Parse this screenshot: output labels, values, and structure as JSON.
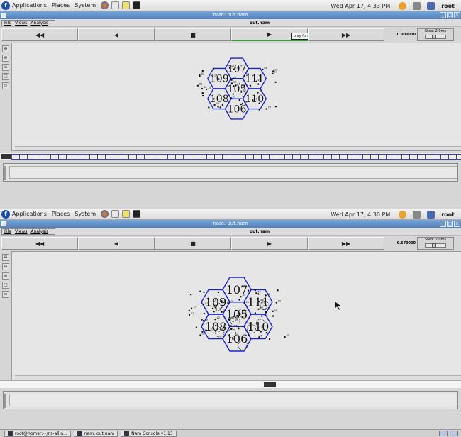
{
  "desktop": {
    "apps_menu": "Applications",
    "places_menu": "Places",
    "system_menu": "System",
    "user": "root"
  },
  "shot1": {
    "clock": "Wed Apr 17,  4:33 PM",
    "window_title": "nam: out.nam",
    "menu": {
      "file": "File",
      "views": "Views",
      "analysis": "Analysis"
    },
    "file_name": "out.nam",
    "controls": {
      "rewind": "◀◀",
      "back": "◀",
      "stop": "■",
      "play": "▶",
      "fastfwd": "▶▶"
    },
    "tooltip": "play forward",
    "time": "0.000000",
    "step_label": "Step: 2.0ms"
  },
  "shot2": {
    "clock": "Wed Apr 17,  4:30 PM",
    "window_title": "nam: out.nam",
    "menu": {
      "file": "File",
      "views": "Views",
      "analysis": "Analysis"
    },
    "file_name": "out.nam",
    "controls": {
      "rewind": "◀◀",
      "back": "◀",
      "stop": "■",
      "play": "▶",
      "fastfwd": "▶▶"
    },
    "time": "9.670000",
    "step_label": "Step: 2.0ms"
  },
  "hexagons": [
    {
      "label": "107",
      "q": 0,
      "r": -1
    },
    {
      "label": "109",
      "q": -1,
      "r": -0.5
    },
    {
      "label": "111",
      "q": 1,
      "r": -0.5
    },
    {
      "label": "105",
      "q": 0,
      "r": 0
    },
    {
      "label": "108",
      "q": -1,
      "r": 0.5
    },
    {
      "label": "110",
      "q": 1,
      "r": 0.5
    },
    {
      "label": "106",
      "q": 0,
      "r": 1
    }
  ],
  "node_labels": [
    "82",
    "43",
    "49",
    "22",
    "37",
    "77",
    "15",
    "70",
    "47",
    "86",
    "35",
    "96",
    "92",
    "64",
    "19",
    "11",
    "48",
    "63",
    "21",
    "61",
    "51",
    "6",
    "17",
    "12",
    "45"
  ],
  "colors": {
    "hex": "#1a24c8",
    "node": "#111111",
    "titlebar": "#5f8fca"
  },
  "taskbar": {
    "items": [
      "root@homer:~/ns-allin...",
      "nam: out.nam",
      "Nam Console v1.13"
    ]
  }
}
